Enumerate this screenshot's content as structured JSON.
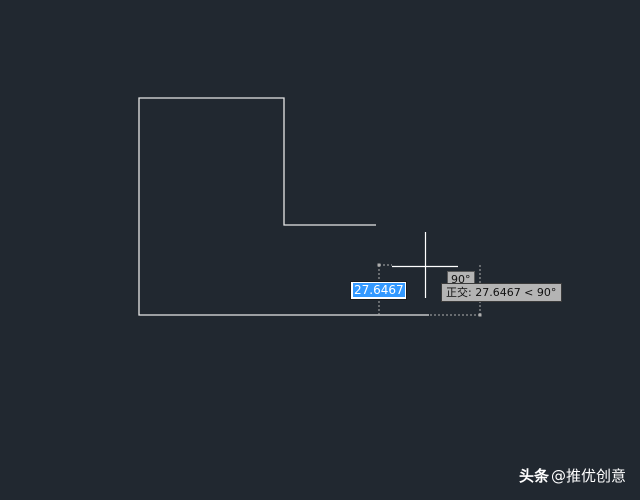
{
  "dimension_input": {
    "value": "27.6467"
  },
  "angle_tag": {
    "text": "90°"
  },
  "tooltip": {
    "text": "正交: 27.6467 < 90°"
  },
  "watermark": {
    "brand": "头条",
    "handle": "@推优创意"
  },
  "colors": {
    "canvas_background": "#212830",
    "geometry": "#e6e6e6",
    "selection": "#3399ff",
    "tooltip_background": "#b4b4b4"
  }
}
